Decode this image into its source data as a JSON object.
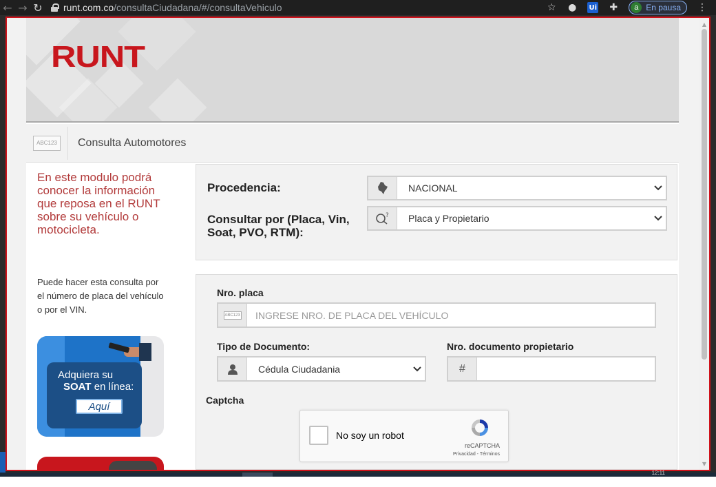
{
  "browser": {
    "url_host": "runt.com.co",
    "url_path": "/consultaCiudadana/#/consultaVehiculo",
    "profile_initial": "a",
    "profile_status": "En pausa"
  },
  "site": {
    "logo_text": "RUNT",
    "title_badge": "ABC123",
    "title": "Consulta Automotores",
    "intro_text": "En este modulo podrá conocer la información que reposa en el RUNT sobre su vehículo o motocicleta.",
    "help_text": "Puede hacer esta consulta por el número de placa del vehículo o por el VIN.",
    "soat_ad": {
      "line1": "Adquiera su",
      "line2_bold": "SOAT",
      "line2_rest": " en línea:",
      "button": "Aquí"
    }
  },
  "form": {
    "procedencia_label": "Procedencia:",
    "procedencia_value": "NACIONAL",
    "consultar_label": "Consultar por (Placa, Vin, Soat, PVO, RTM):",
    "consultar_value": "Placa y Propietario",
    "placa_label": "Nro. placa",
    "placa_badge": "ABC123",
    "placa_placeholder": "INGRESE NRO. DE PLACA DEL VEHÍCULO",
    "tipo_doc_label": "Tipo de Documento:",
    "tipo_doc_value": "Cédula Ciudadania",
    "nro_doc_label": "Nro. documento propietario",
    "nro_doc_prefix": "#",
    "captcha_label": "Captcha",
    "captcha_text": "No soy un robot",
    "captcha_brand": "reCAPTCHA",
    "captcha_terms": "Privacidad - Términos"
  },
  "taskbar": {
    "time": "12:11"
  },
  "colors": {
    "runt_red": "#c8161d",
    "intro_red": "#b23a3a",
    "frame_red": "#d0121b",
    "soat_blue": "#1e73c8"
  }
}
